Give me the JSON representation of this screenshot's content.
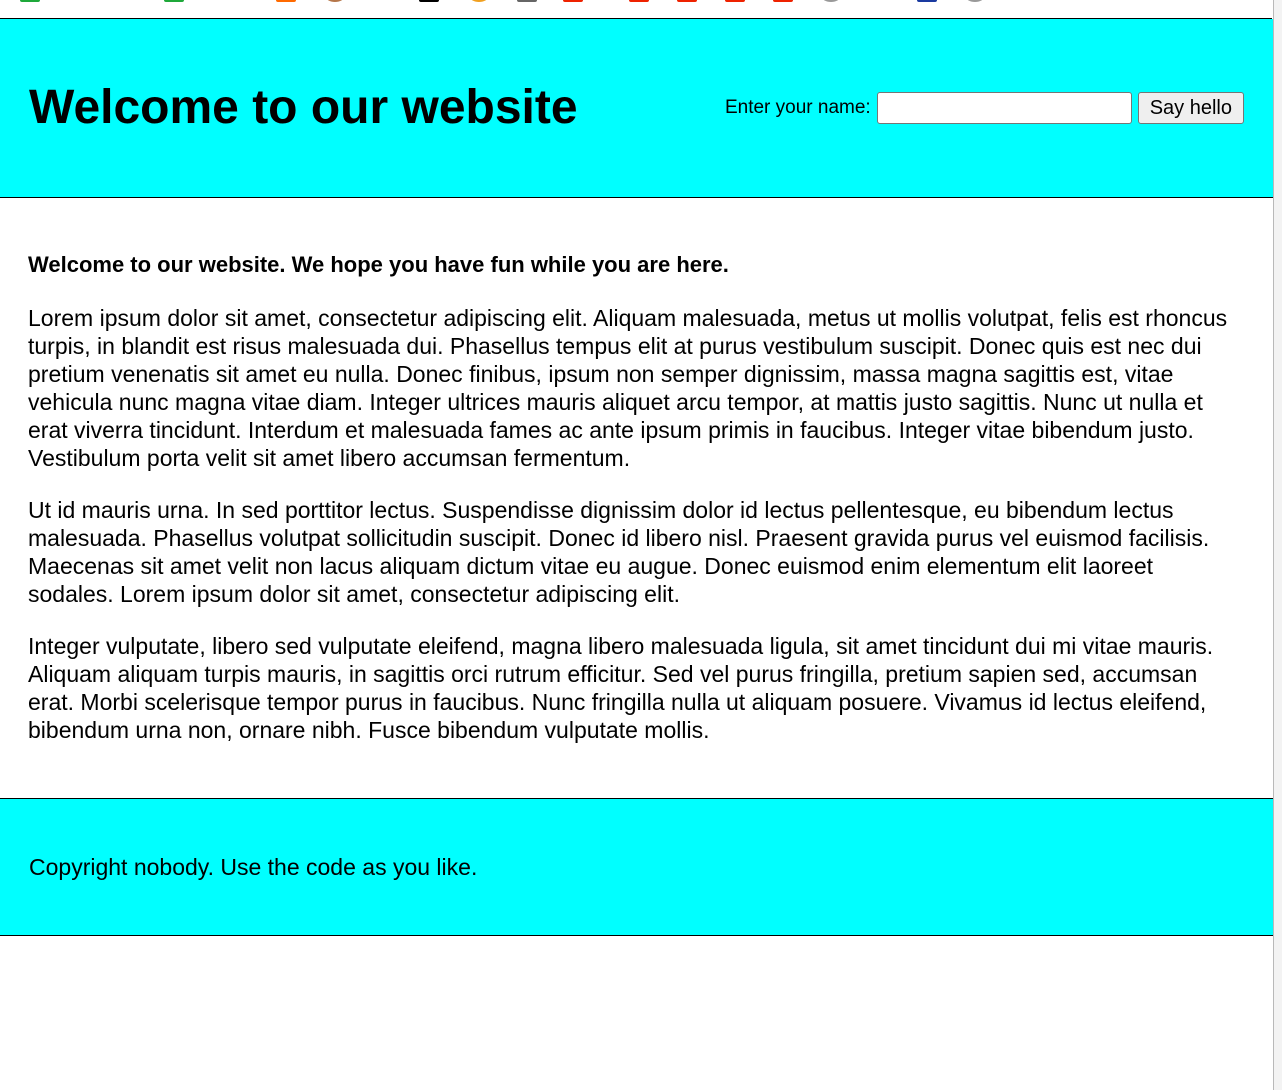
{
  "colors": {
    "header_background": "#00ffff",
    "footer_background": "#00ffff",
    "page_background": "#ffffff",
    "text": "#000000"
  },
  "bookmarks_bar": {
    "icons": [
      {
        "name": "green-favicon-icon",
        "color": "#1fa83a",
        "shape": "square"
      },
      {
        "name": "green-favicon-icon",
        "color": "#1fa83a",
        "shape": "square"
      },
      {
        "name": "orange-favicon-icon",
        "color": "#ff6a00",
        "shape": "square"
      },
      {
        "name": "brown-circle-favicon-icon",
        "color": "#b5764a",
        "shape": "round"
      },
      {
        "name": "black-favicon-icon",
        "color": "#000000",
        "shape": "square"
      },
      {
        "name": "orange-circle-favicon-icon",
        "color": "#f0a020",
        "shape": "round"
      },
      {
        "name": "gray-favicon-icon",
        "color": "#666666",
        "shape": "square"
      },
      {
        "name": "red-favicon-icon",
        "color": "#ee2200",
        "shape": "square"
      },
      {
        "name": "red-favicon-icon",
        "color": "#ee2200",
        "shape": "square"
      },
      {
        "name": "red-favicon-icon",
        "color": "#ee2200",
        "shape": "square"
      },
      {
        "name": "red-favicon-icon",
        "color": "#ee2200",
        "shape": "square"
      },
      {
        "name": "red-favicon-icon",
        "color": "#ee2200",
        "shape": "square"
      },
      {
        "name": "gray-circle-favicon-icon",
        "color": "#999999",
        "shape": "round"
      },
      {
        "name": "blue-favicon-icon",
        "color": "#1a3aa0",
        "shape": "square"
      },
      {
        "name": "gray-circle-favicon-icon",
        "color": "#999999",
        "shape": "round"
      }
    ]
  },
  "header": {
    "title": "Welcome to our website",
    "form": {
      "label": "Enter your name:",
      "input_value": "",
      "button_label": "Say hello"
    }
  },
  "main": {
    "lead": "Welcome to our website. We hope you have fun while you are here.",
    "paragraphs": [
      "Lorem ipsum dolor sit amet, consectetur adipiscing elit. Aliquam malesuada, metus ut mollis volutpat, felis est rhoncus turpis, in blandit est risus malesuada dui. Phasellus tempus elit at purus vestibulum suscipit. Donec quis est nec dui pretium venenatis sit amet eu nulla. Donec finibus, ipsum non semper dignissim, massa magna sagittis est, vitae vehicula nunc magna vitae diam. Integer ultrices mauris aliquet arcu tempor, at mattis justo sagittis. Nunc ut nulla et erat viverra tincidunt. Interdum et malesuada fames ac ante ipsum primis in faucibus. Integer vitae bibendum justo. Vestibulum porta velit sit amet libero accumsan fermentum.",
      "Ut id mauris urna. In sed porttitor lectus. Suspendisse dignissim dolor id lectus pellentesque, eu bibendum lectus malesuada. Phasellus volutpat sollicitudin suscipit. Donec id libero nisl. Praesent gravida purus vel euismod facilisis. Maecenas sit amet velit non lacus aliquam dictum vitae eu augue. Donec euismod enim elementum elit laoreet sodales. Lorem ipsum dolor sit amet, consectetur adipiscing elit.",
      "Integer vulputate, libero sed vulputate eleifend, magna libero malesuada ligula, sit amet tincidunt dui mi vitae mauris. Aliquam aliquam turpis mauris, in sagittis orci rutrum efficitur. Sed vel purus fringilla, pretium sapien sed, accumsan erat. Morbi scelerisque tempor purus in faucibus. Nunc fringilla nulla ut aliquam posuere. Vivamus id lectus eleifend, bibendum urna non, ornare nibh. Fusce bibendum vulputate mollis."
    ]
  },
  "footer": {
    "text": "Copyright nobody. Use the code as you like."
  }
}
